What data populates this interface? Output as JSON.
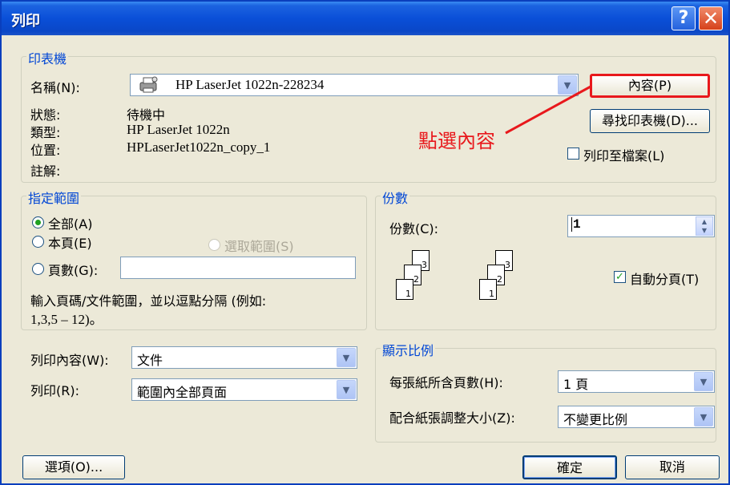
{
  "window": {
    "title": "列印",
    "help_icon": "?",
    "close_icon": "✕"
  },
  "printer": {
    "group_label": "印表機",
    "name_label": "名稱(N):",
    "name_value": "HP LaserJet 1022n-228234",
    "status_label": "狀態:",
    "status_value": "待機中",
    "type_label": "類型:",
    "type_value": "HP LaserJet 1022n",
    "location_label": "位置:",
    "location_value": "HPLaserJet1022n_copy_1",
    "comment_label": "註解:",
    "properties_button": "內容(P)",
    "find_printer_button": "尋找印表機(D)...",
    "print_to_file_label": "列印至檔案(L)",
    "print_to_file_checked": false
  },
  "annotation": {
    "text": "點選內容",
    "color": "#e8181c"
  },
  "range": {
    "group_label": "指定範圍",
    "all_label": "全部(A)",
    "current_page_label": "本頁(E)",
    "selection_label": "選取範圍(S)",
    "pages_label": "頁數(G):",
    "pages_value": "",
    "selected": "all",
    "hint": "輸入頁碼/文件範圍，並以逗點分隔 (例如:",
    "hint_example": "1,3,5 – 12)。"
  },
  "copies": {
    "group_label": "份數",
    "copies_label": "份數(C):",
    "copies_value": "1",
    "collate_label": "自動分頁(T)",
    "collate_checked": true,
    "page_numbers": [
      "1",
      "2",
      "3"
    ]
  },
  "print_what": {
    "label": "列印內容(W):",
    "value": "文件",
    "print_label": "列印(R):",
    "print_value": "範圍內全部頁面"
  },
  "zoom": {
    "group_label": "顯示比例",
    "pages_per_sheet_label": "每張紙所含頁數(H):",
    "pages_per_sheet_value": "1 頁",
    "scale_label": "配合紙張調整大小(Z):",
    "scale_value": "不變更比例"
  },
  "footer": {
    "options_button": "選項(O)...",
    "ok_button": "確定",
    "cancel_button": "取消"
  },
  "colors": {
    "accent": "#0046d5",
    "titlebar": "#0a4fd8",
    "highlight_border": "#e8181c"
  }
}
